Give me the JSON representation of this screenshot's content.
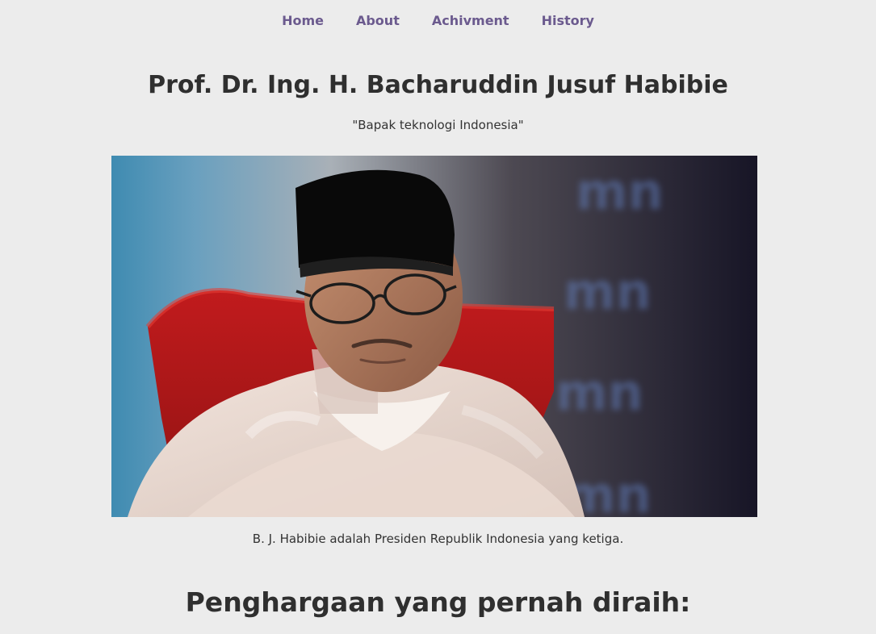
{
  "nav": {
    "items": [
      {
        "label": "Home"
      },
      {
        "label": "About"
      },
      {
        "label": "Achivment"
      },
      {
        "label": "History"
      }
    ]
  },
  "header": {
    "title": "Prof. Dr. Ing. H. Bacharuddin Jusuf Habibie",
    "subtitle": "\"Bapak teknologi Indonesia\""
  },
  "figure": {
    "caption": "B. J. Habibie adalah Presiden Republik Indonesia yang ketiga."
  },
  "section": {
    "title": "Penghargaan yang pernah diraih:"
  }
}
